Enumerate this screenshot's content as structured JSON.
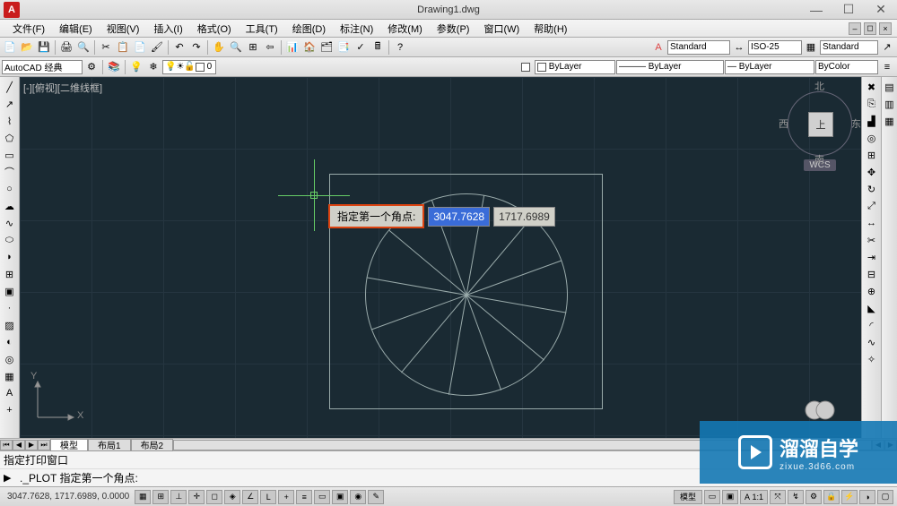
{
  "app": {
    "icon_letter": "A",
    "title": "Drawing1.dwg",
    "win_min": "—",
    "win_max": "☐",
    "win_close": "✕"
  },
  "menu": {
    "items": [
      "文件(F)",
      "编辑(E)",
      "视图(V)",
      "插入(I)",
      "格式(O)",
      "工具(T)",
      "绘图(D)",
      "标注(N)",
      "修改(M)",
      "参数(P)",
      "窗口(W)",
      "帮助(H)"
    ]
  },
  "toolbar1": {
    "style1": "Standard",
    "style2": "ISO-25",
    "style3": "Standard"
  },
  "toolbar2": {
    "workspace": "AutoCAD 经典",
    "layer_state": "",
    "layer": "0",
    "layer_prop": "ByLayer",
    "lineweight": "ByLayer",
    "linetype": "ByLayer",
    "plotcolor": "ByColor"
  },
  "canvas": {
    "viewport_label": "[-][俯视][二维线框]",
    "ucs_x": "X",
    "ucs_y": "Y",
    "viewcube": {
      "n": "北",
      "s": "南",
      "e": "东",
      "w": "西",
      "top": "上"
    },
    "wcs": "WCS"
  },
  "prompt": {
    "label": "指定第一个角点:",
    "value1": "3047.7628",
    "value2": "1717.6989"
  },
  "tabs": {
    "model": "模型",
    "layout1": "布局1",
    "layout2": "布局2"
  },
  "command": {
    "history1": "指定打印窗口",
    "prompt": "._PLOT 指定第一个角点:"
  },
  "status": {
    "coords": "3047.7628, 1717.6989, 0.0000",
    "model_btn": "模型",
    "scale": "1:1",
    "ann": "A"
  },
  "watermark": {
    "main": "溜溜自学",
    "sub": "zixue.3d66.com"
  }
}
